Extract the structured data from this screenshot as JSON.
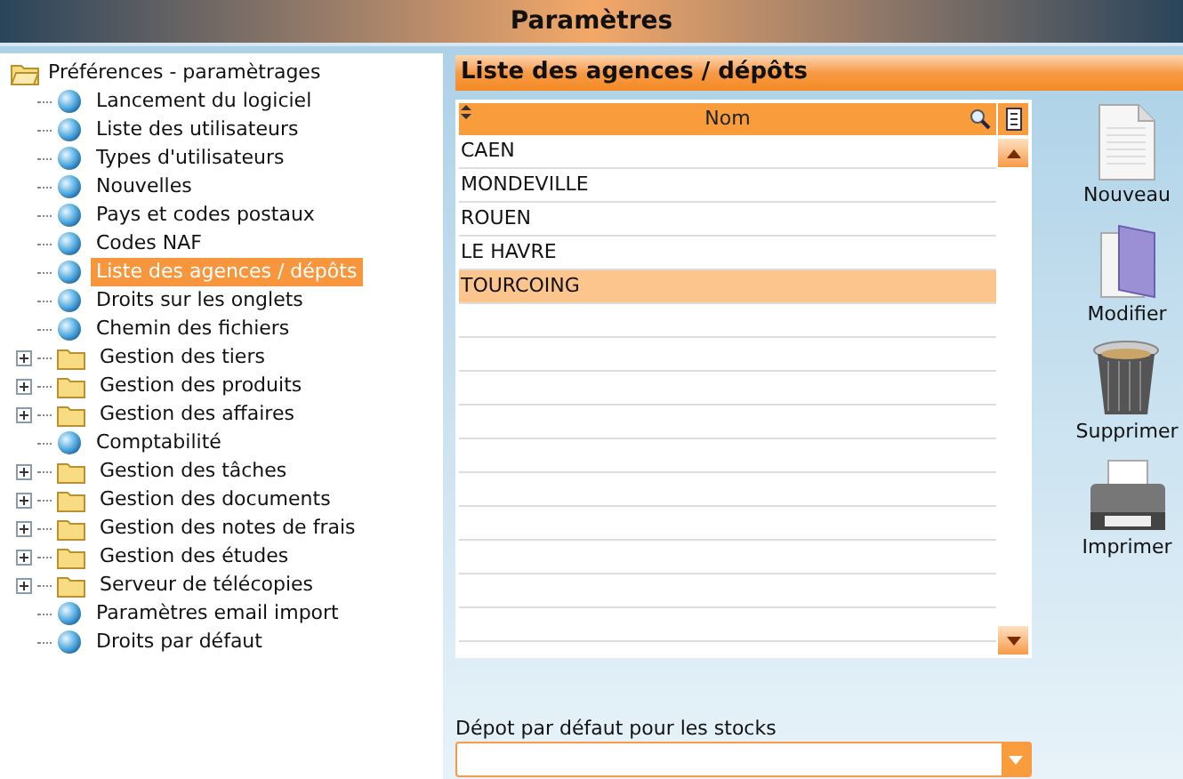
{
  "window": {
    "title": "Paramètres"
  },
  "tree": {
    "label": "Préférences - paramètrages",
    "expanded": true,
    "children": [
      {
        "label": "Lancement du logiciel",
        "kind": "page",
        "selected": false
      },
      {
        "label": "Liste des utilisateurs",
        "kind": "page",
        "selected": false
      },
      {
        "label": "Types d'utilisateurs",
        "kind": "page",
        "selected": false
      },
      {
        "label": "Nouvelles",
        "kind": "page",
        "selected": false
      },
      {
        "label": "Pays et codes postaux",
        "kind": "page",
        "selected": false
      },
      {
        "label": "Codes NAF",
        "kind": "page",
        "selected": false
      },
      {
        "label": "Liste des agences / dépôts",
        "kind": "page",
        "selected": true
      },
      {
        "label": "Droits sur les onglets",
        "kind": "page",
        "selected": false
      },
      {
        "label": "Chemin des fichiers",
        "kind": "page",
        "selected": false
      },
      {
        "label": "Gestion des tiers",
        "kind": "folder",
        "expanded": false,
        "selected": false
      },
      {
        "label": "Gestion des produits",
        "kind": "folder",
        "expanded": false,
        "selected": false
      },
      {
        "label": "Gestion des affaires",
        "kind": "folder",
        "expanded": false,
        "selected": false
      },
      {
        "label": "Comptabilité",
        "kind": "page",
        "selected": false
      },
      {
        "label": "Gestion des tâches",
        "kind": "folder",
        "expanded": false,
        "selected": false
      },
      {
        "label": "Gestion des documents",
        "kind": "folder",
        "expanded": false,
        "selected": false
      },
      {
        "label": "Gestion des notes de frais",
        "kind": "folder",
        "expanded": false,
        "selected": false
      },
      {
        "label": "Gestion des études",
        "kind": "folder",
        "expanded": false,
        "selected": false
      },
      {
        "label": "Serveur de télécopies",
        "kind": "folder",
        "expanded": false,
        "selected": false
      },
      {
        "label": "Paramètres email import",
        "kind": "page",
        "selected": false
      },
      {
        "label": "Droits par défaut",
        "kind": "page",
        "selected": false
      }
    ]
  },
  "panel": {
    "title": "Liste des agences / dépôts"
  },
  "table": {
    "columns": [
      "Nom"
    ],
    "rows": [
      {
        "cells": [
          "CAEN"
        ],
        "selected": false
      },
      {
        "cells": [
          "MONDEVILLE"
        ],
        "selected": false
      },
      {
        "cells": [
          "ROUEN"
        ],
        "selected": false
      },
      {
        "cells": [
          "LE HAVRE"
        ],
        "selected": false
      },
      {
        "cells": [
          "TOURCOING"
        ],
        "selected": true
      }
    ]
  },
  "actions": [
    {
      "label": "Nouveau",
      "kind": "new"
    },
    {
      "label": "Modifier",
      "kind": "edit"
    },
    {
      "label": "Supprimer",
      "kind": "delete"
    },
    {
      "label": "Imprimer",
      "kind": "print"
    }
  ],
  "default_depot": {
    "label": "Dépot par défaut pour les stocks"
  }
}
